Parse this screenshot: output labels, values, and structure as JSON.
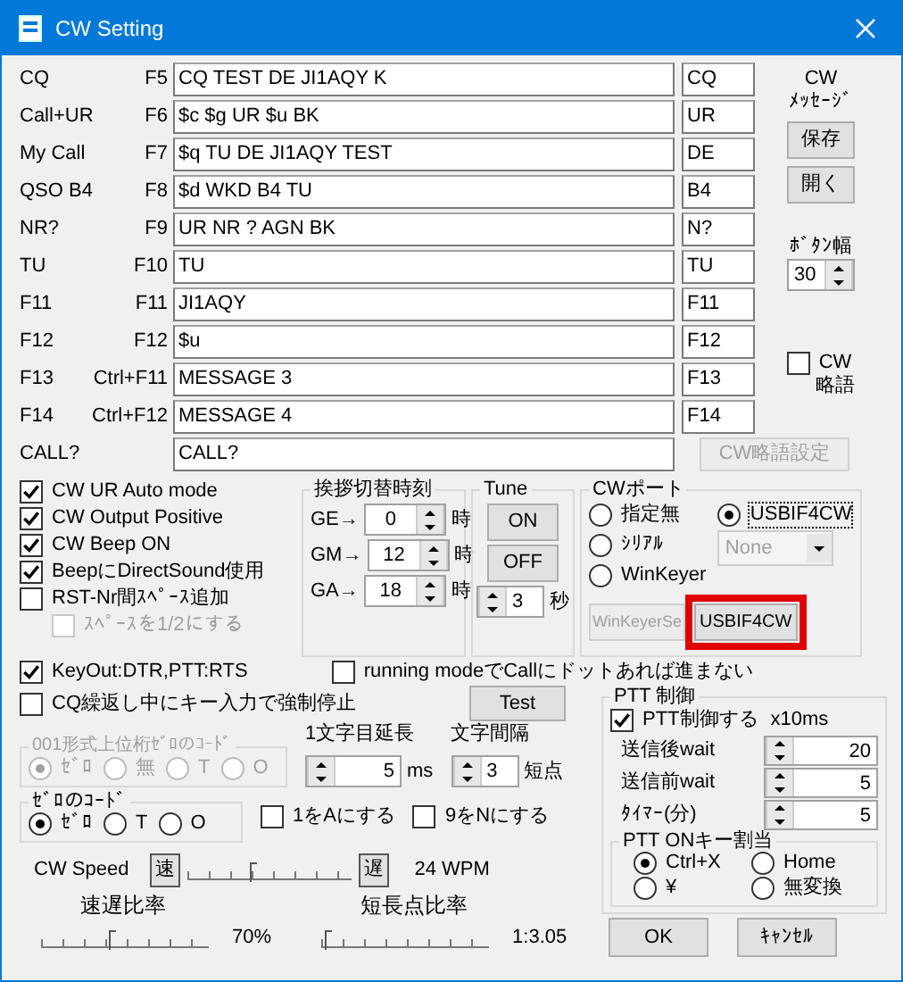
{
  "window": {
    "title": "CW Setting"
  },
  "messages": [
    {
      "name": "CQ",
      "key": "F5",
      "text": "CQ TEST DE JI1AQY K",
      "short": "CQ"
    },
    {
      "name": "Call+UR",
      "key": "F6",
      "text": "$c $g UR $u BK",
      "short": "UR"
    },
    {
      "name": "My Call",
      "key": "F7",
      "text": "$q TU DE JI1AQY TEST",
      "short": "DE"
    },
    {
      "name": "QSO B4",
      "key": "F8",
      "text": "$d WKD B4 TU",
      "short": "B4"
    },
    {
      "name": "NR?",
      "key": "F9",
      "text": "UR NR ? AGN BK",
      "short": "N?"
    },
    {
      "name": "TU",
      "key": "F10",
      "text": "TU",
      "short": "TU"
    },
    {
      "name": "F11",
      "key": "F11",
      "text": "JI1AQY",
      "short": "F11"
    },
    {
      "name": "F12",
      "key": "F12",
      "text": "$u",
      "short": "F12"
    },
    {
      "name": "F13",
      "key": "Ctrl+F11",
      "text": "MESSAGE 3",
      "short": "F13"
    },
    {
      "name": "F14",
      "key": "Ctrl+F12",
      "text": "MESSAGE 4",
      "short": "F14"
    }
  ],
  "call": {
    "label": "CALL?",
    "value": "CALL?"
  },
  "cw_message": {
    "label": [
      "CW",
      "ﾒｯｾｰｼﾞ"
    ],
    "buttons": [
      "保存",
      "開く"
    ]
  },
  "button_width": {
    "label": "ﾎﾞﾀﾝ幅",
    "value": "30"
  },
  "cw_abbrev": {
    "label": [
      "CW",
      "略語"
    ],
    "checked": false,
    "settings_button": "CW略語設定",
    "settings_disabled": true
  },
  "options": [
    {
      "label": "CW UR Auto mode",
      "checked": true,
      "disabled": false
    },
    {
      "label": "CW Output Positive",
      "checked": true,
      "disabled": false
    },
    {
      "label": "CW Beep ON",
      "checked": true,
      "disabled": false
    },
    {
      "label": "BeepにDirectSound使用",
      "checked": true,
      "disabled": false
    },
    {
      "label": "RST-Nr間ｽﾍﾟｰｽ追加",
      "checked": false,
      "disabled": false,
      "children": [
        {
          "label": "ｽﾍﾟｰｽを1/2にする",
          "checked": false,
          "disabled": true
        }
      ]
    }
  ],
  "greeting": {
    "title": "挨拶切替時刻",
    "rows": [
      {
        "label": "GE→",
        "value": "0",
        "unit": "時"
      },
      {
        "label": "GM→",
        "value": "12",
        "unit": "時"
      },
      {
        "label": "GA→",
        "value": "18",
        "unit": "時"
      }
    ]
  },
  "tune": {
    "title": "Tune",
    "buttons": [
      "ON",
      "OFF"
    ],
    "value": "3",
    "unit": "秒"
  },
  "cw_port": {
    "title": "CWポート",
    "radios": [
      {
        "label": "指定無",
        "selected": false
      },
      {
        "label": "ｼﾘｱﾙ",
        "selected": false
      },
      {
        "label": "WinKeyer",
        "selected": false
      },
      {
        "label": "USBIF4CW",
        "selected": true
      }
    ],
    "dropdown": {
      "value": "None",
      "disabled": true
    },
    "buttons": [
      {
        "label": "WinKeyerSe",
        "disabled": true,
        "highlighted": false
      },
      {
        "label": "USBIF4CW",
        "disabled": false,
        "highlighted": true
      }
    ]
  },
  "keyout": {
    "label": "KeyOut:DTR,PTT:RTS",
    "checked": true
  },
  "running_mode": {
    "label": "running modeでCallにドットあれば進まない",
    "checked": false
  },
  "cq_stop": {
    "label": "CQ繰返し中にキー入力で強制停止",
    "checked": false
  },
  "test_button": "Test",
  "code_001": {
    "title": "001形式上位桁ｾﾞﾛのｺｰﾄﾞ",
    "disabled": true,
    "radios": [
      {
        "label": "ｾﾞﾛ",
        "selected": true
      },
      {
        "label": "無",
        "selected": false
      },
      {
        "label": "T",
        "selected": false
      },
      {
        "label": "O",
        "selected": false
      }
    ]
  },
  "first_char_delay": {
    "label": "1文字目延長",
    "value": "5",
    "unit": "ms"
  },
  "char_spacing": {
    "label": "文字間隔",
    "value": "3",
    "unit": "短点"
  },
  "zero_code": {
    "title": "ｾﾞﾛのｺｰﾄﾞ",
    "radios": [
      {
        "label": "ｾﾞﾛ",
        "selected": true
      },
      {
        "label": "T",
        "selected": false
      },
      {
        "label": "O",
        "selected": false
      }
    ]
  },
  "conversions": [
    {
      "label": "1をAにする",
      "checked": false
    },
    {
      "label": "9をNにする",
      "checked": false
    }
  ],
  "cw_speed": {
    "label": "CW Speed",
    "fast": "速",
    "slow": "遅",
    "level": 0.39,
    "reading": "24 WPM"
  },
  "speed_ratio": {
    "label": "速遅比率",
    "level": 0.41,
    "reading": "70%"
  },
  "dot_ratio": {
    "label": "短長点比率",
    "level": 0.03,
    "reading": "1:3.05"
  },
  "ptt": {
    "title": "PTT 制御",
    "checkbox": {
      "label": "PTT制御する",
      "checked": true
    },
    "unit": "x10ms",
    "rows": [
      {
        "label": "送信後wait",
        "value": "20"
      },
      {
        "label": "送信前wait",
        "value": "5"
      },
      {
        "label": "ﾀｲﾏｰ(分)",
        "value": "5"
      }
    ],
    "key_group": {
      "title": "PTT ONキー割当",
      "radios": [
        {
          "label": "Ctrl+X",
          "selected": true
        },
        {
          "label": "Home",
          "selected": false
        },
        {
          "label": "¥",
          "selected": false
        },
        {
          "label": "無変換",
          "selected": false
        }
      ]
    }
  },
  "buttons": [
    "OK",
    "ｷｬﾝｾﾙ"
  ]
}
